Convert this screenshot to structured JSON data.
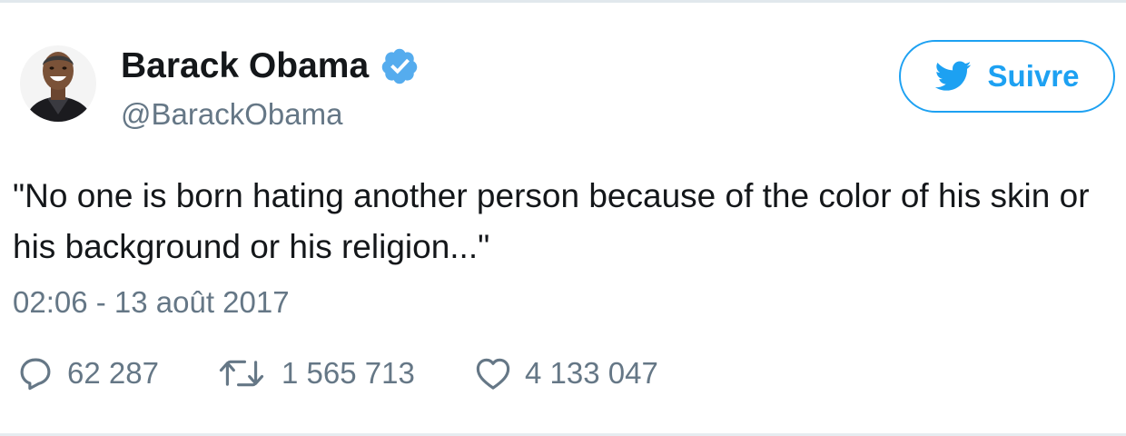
{
  "user": {
    "name": "Barack Obama",
    "handle": "@BarackObama",
    "verified": true
  },
  "follow_button": {
    "label": "Suivre",
    "icon": "twitter-bird-icon"
  },
  "tweet": {
    "text": "\"No one is born hating another person because of the color of his skin or his background or his religion...\"",
    "timestamp": "02:06 - 13 août 2017"
  },
  "actions": {
    "reply_count": "62 287",
    "retweet_count": "1 565 713",
    "like_count": "4 133 047"
  },
  "icons": {
    "reply": "reply-icon",
    "retweet": "retweet-icon",
    "like": "heart-icon",
    "verified": "verified-badge-icon"
  },
  "colors": {
    "accent": "#1da1f2",
    "text": "#14171a",
    "secondary": "#657786"
  }
}
